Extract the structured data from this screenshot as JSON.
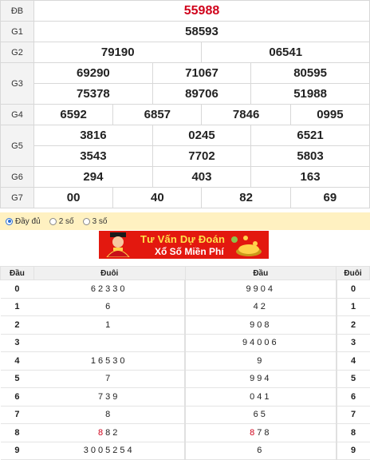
{
  "results": [
    {
      "label": "ĐB",
      "values": [
        "55988"
      ]
    },
    {
      "label": "G1",
      "values": [
        "58593"
      ]
    },
    {
      "label": "G2",
      "values": [
        "79190",
        "06541"
      ]
    },
    {
      "label": "G3",
      "values": [
        "69290",
        "71067",
        "80595",
        "75378",
        "89706",
        "51988"
      ]
    },
    {
      "label": "G4",
      "values": [
        "6592",
        "6857",
        "7846",
        "0995"
      ]
    },
    {
      "label": "G5",
      "values": [
        "3816",
        "0245",
        "6521",
        "3543",
        "7702",
        "5803"
      ]
    },
    {
      "label": "G6",
      "values": [
        "294",
        "403",
        "163"
      ]
    },
    {
      "label": "G7",
      "values": [
        "00",
        "40",
        "82",
        "69"
      ]
    }
  ],
  "options": [
    {
      "label": "Đầy đủ",
      "selected": true
    },
    {
      "label": "2 số",
      "selected": false
    },
    {
      "label": "3 số",
      "selected": false
    }
  ],
  "banner": {
    "line1": "Tư Vấn Dự Đoán",
    "line2": "Xổ Số Miền Phí"
  },
  "loto_headers": [
    "Đầu",
    "Đuôi",
    "Đầu",
    "Đuôi"
  ],
  "loto": [
    {
      "dau": "0",
      "duoi": "62330",
      "dau2": "9904",
      "duoi2": "0"
    },
    {
      "dau": "1",
      "duoi": "6",
      "dau2": "42",
      "duoi2": "1"
    },
    {
      "dau": "2",
      "duoi": "1",
      "dau2": "908",
      "duoi2": "2"
    },
    {
      "dau": "3",
      "duoi": "",
      "dau2": "94006",
      "duoi2": "3"
    },
    {
      "dau": "4",
      "duoi": "16530",
      "dau2": "9",
      "duoi2": "4"
    },
    {
      "dau": "5",
      "duoi": "7",
      "dau2": "994",
      "duoi2": "5"
    },
    {
      "dau": "6",
      "duoi": "739",
      "dau2": "041",
      "duoi2": "6"
    },
    {
      "dau": "7",
      "duoi": "8",
      "dau2": "65",
      "duoi2": "7"
    },
    {
      "dau": "8",
      "duoi_red": "8",
      "duoi": "82",
      "dau2_red": "8",
      "dau2": "78",
      "duoi2": "8"
    },
    {
      "dau": "9",
      "duoi": "3005254",
      "dau2": "6",
      "duoi2": "9"
    }
  ]
}
